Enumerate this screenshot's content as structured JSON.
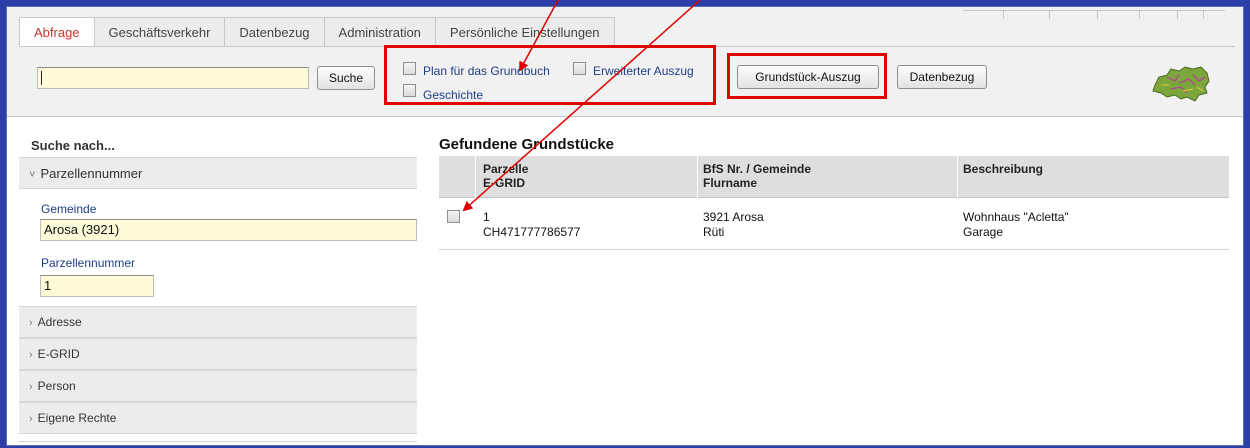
{
  "tabs": [
    {
      "label": "Abfrage",
      "active": true
    },
    {
      "label": "Geschäftsverkehr",
      "active": false
    },
    {
      "label": "Datenbezug",
      "active": false
    },
    {
      "label": "Administration",
      "active": false
    },
    {
      "label": "Persönliche Einstellungen",
      "active": false
    }
  ],
  "toolbar": {
    "search_value": "",
    "search_button": "Suche",
    "options": [
      {
        "label": "Plan für das Grundbuch",
        "checked": false
      },
      {
        "label": "Erweiterter Auszug",
        "checked": false
      },
      {
        "label": "Geschichte",
        "checked": false
      }
    ],
    "grundstueck_button": "Grundstück-Auszug",
    "datenbezug_button": "Datenbezug"
  },
  "sidebar": {
    "heading": "Suche nach...",
    "sections": [
      {
        "label": "Parzellennummer",
        "expanded": true
      },
      {
        "label": "Adresse",
        "expanded": false
      },
      {
        "label": "E-GRID",
        "expanded": false
      },
      {
        "label": "Person",
        "expanded": false
      },
      {
        "label": "Eigene Rechte",
        "expanded": false
      }
    ],
    "gemeinde_label": "Gemeinde",
    "gemeinde_value": "Arosa (3921)",
    "parzelle_label": "Parzellennummer",
    "parzelle_value": "1"
  },
  "results": {
    "title": "Gefundene Grundstücke",
    "columns": [
      {
        "line1": "Parzelle",
        "line2": "E-GRID"
      },
      {
        "line1": "BfS Nr. / Gemeinde",
        "line2": "Flurname"
      },
      {
        "line1": "Beschreibung",
        "line2": ""
      }
    ],
    "rows": [
      {
        "checked": false,
        "parzelle": "1",
        "egrid": "CH471777786577",
        "gemeinde": "3921 Arosa",
        "flurname": "Rüti",
        "beschreibung1": "Wohnhaus \"Acletta\"",
        "beschreibung2": "Garage"
      }
    ]
  },
  "colors": {
    "active_tab": "#c0392b",
    "annotation": "#e00000",
    "field_bg": "#fdfbd8",
    "label_blue": "#1d3d86"
  },
  "icons": [
    "chevron-down-icon",
    "chevron-right-icon",
    "switzerland-map-icon"
  ]
}
